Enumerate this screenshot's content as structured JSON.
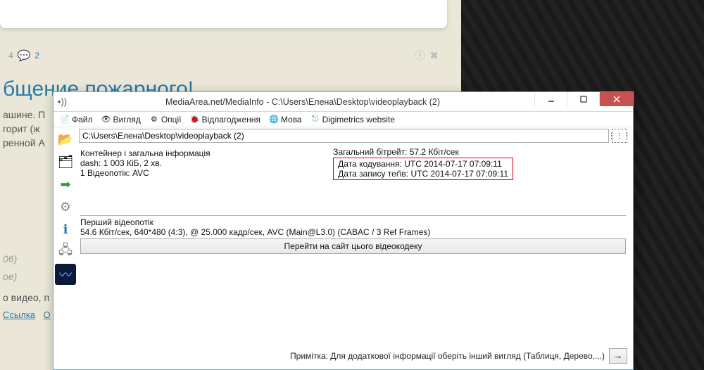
{
  "background": {
    "toolbar": {
      "n1": "4",
      "n2": "2"
    },
    "title": "бщение пожарного!",
    "line1": "ашине. П",
    "line2": "горит (ж",
    "line3": "ренной А",
    "time1": " 06)",
    "time2": "ое)",
    "line4": "о видео, п",
    "link1": "Ссылка",
    "link2": "О"
  },
  "window": {
    "title": "MediaArea.net/MediaInfo - C:\\Users\\Елена\\Desktop\\videoplayback (2)"
  },
  "menu": {
    "file": "Файл",
    "view": "Вигляд",
    "options": "Опції",
    "debug": "Відлагодження",
    "lang": "Мова",
    "digi": "Digimetrics website"
  },
  "path": "C:\\Users\\Елена\\Desktop\\videoplayback (2)",
  "container": {
    "header": "Контейнер і загальна інформація",
    "line1": "dash: 1 003 КіБ, 2 хв.",
    "line2": "1 Відеопотік: AVC",
    "bitrate": "Загальний бітрейт: 57.2 Кбіт/сек",
    "encoded": "Дата кодування: UTC 2014-07-17 07:09:11",
    "tagged": "Дата запису теґів: UTC 2014-07-17 07:09:11"
  },
  "video": {
    "header": "Перший відеопотік",
    "line": "54.6 Кбіт/сек, 640*480 (4:3), @ 25.000 кадр/сек, AVC (Main@L3.0) (CABAC / 3 Ref Frames)"
  },
  "codec_btn": "Перейти на сайт цього відеокодеку",
  "footer_note": "Примітка: Для додаткової інформації оберіть інший вигляд (Таблиця, Дерево,...)",
  "arrow": "→"
}
